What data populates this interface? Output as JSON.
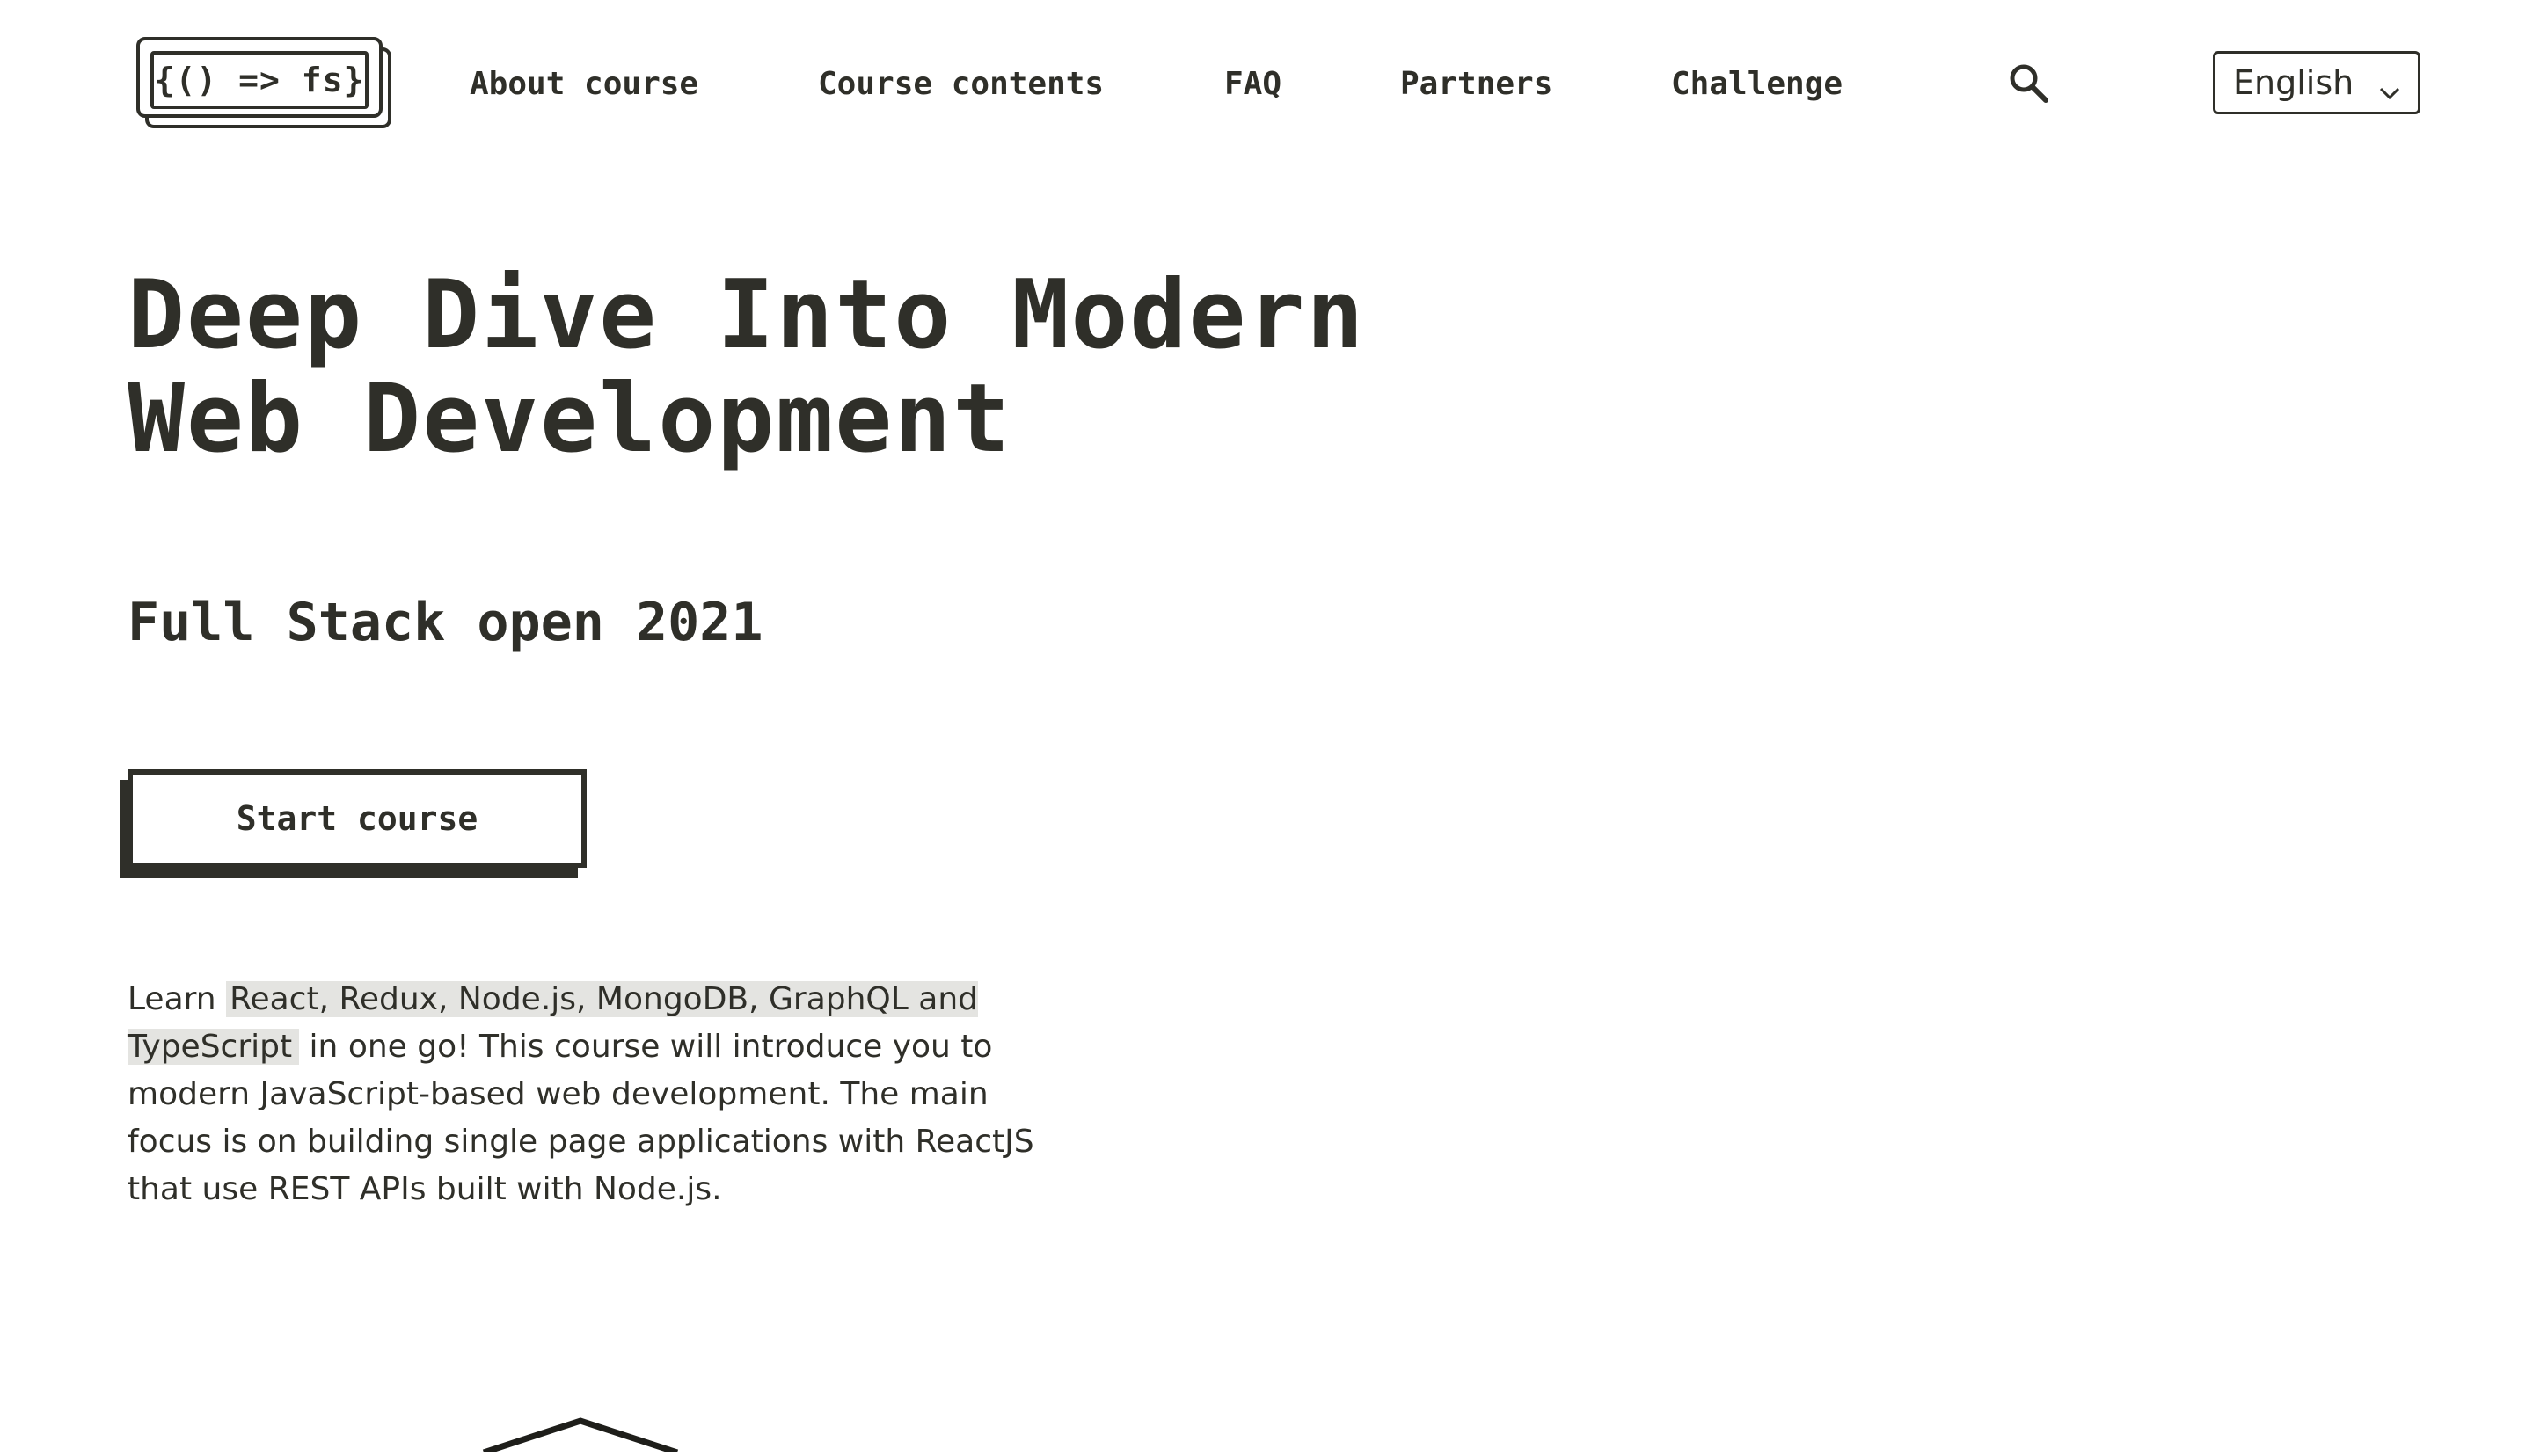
{
  "header": {
    "logo_text": "{() => fs}",
    "nav": [
      {
        "label": "About course"
      },
      {
        "label": "Course contents"
      },
      {
        "label": "FAQ"
      },
      {
        "label": "Partners"
      },
      {
        "label": "Challenge"
      }
    ],
    "search_icon": "search-icon",
    "language": {
      "selected": "English",
      "icon": "chevron-down-icon"
    }
  },
  "hero": {
    "title_line1": "Deep Dive Into Modern",
    "title_line2": "Web Development",
    "subtitle": "Full Stack open 2021",
    "start_button": "Start course",
    "intro_prefix": "Learn ",
    "intro_highlight": "React, Redux, Node.js, MongoDB, GraphQL and TypeScript",
    "intro_rest": " in one go! This course will introduce you to modern JavaScript-based web development. The main focus is on building single page applications with ReactJS that use REST APIs built with Node.js."
  },
  "colors": {
    "text": "#2f2f29",
    "background": "#ffffff",
    "highlight": "#e4e4e1"
  }
}
